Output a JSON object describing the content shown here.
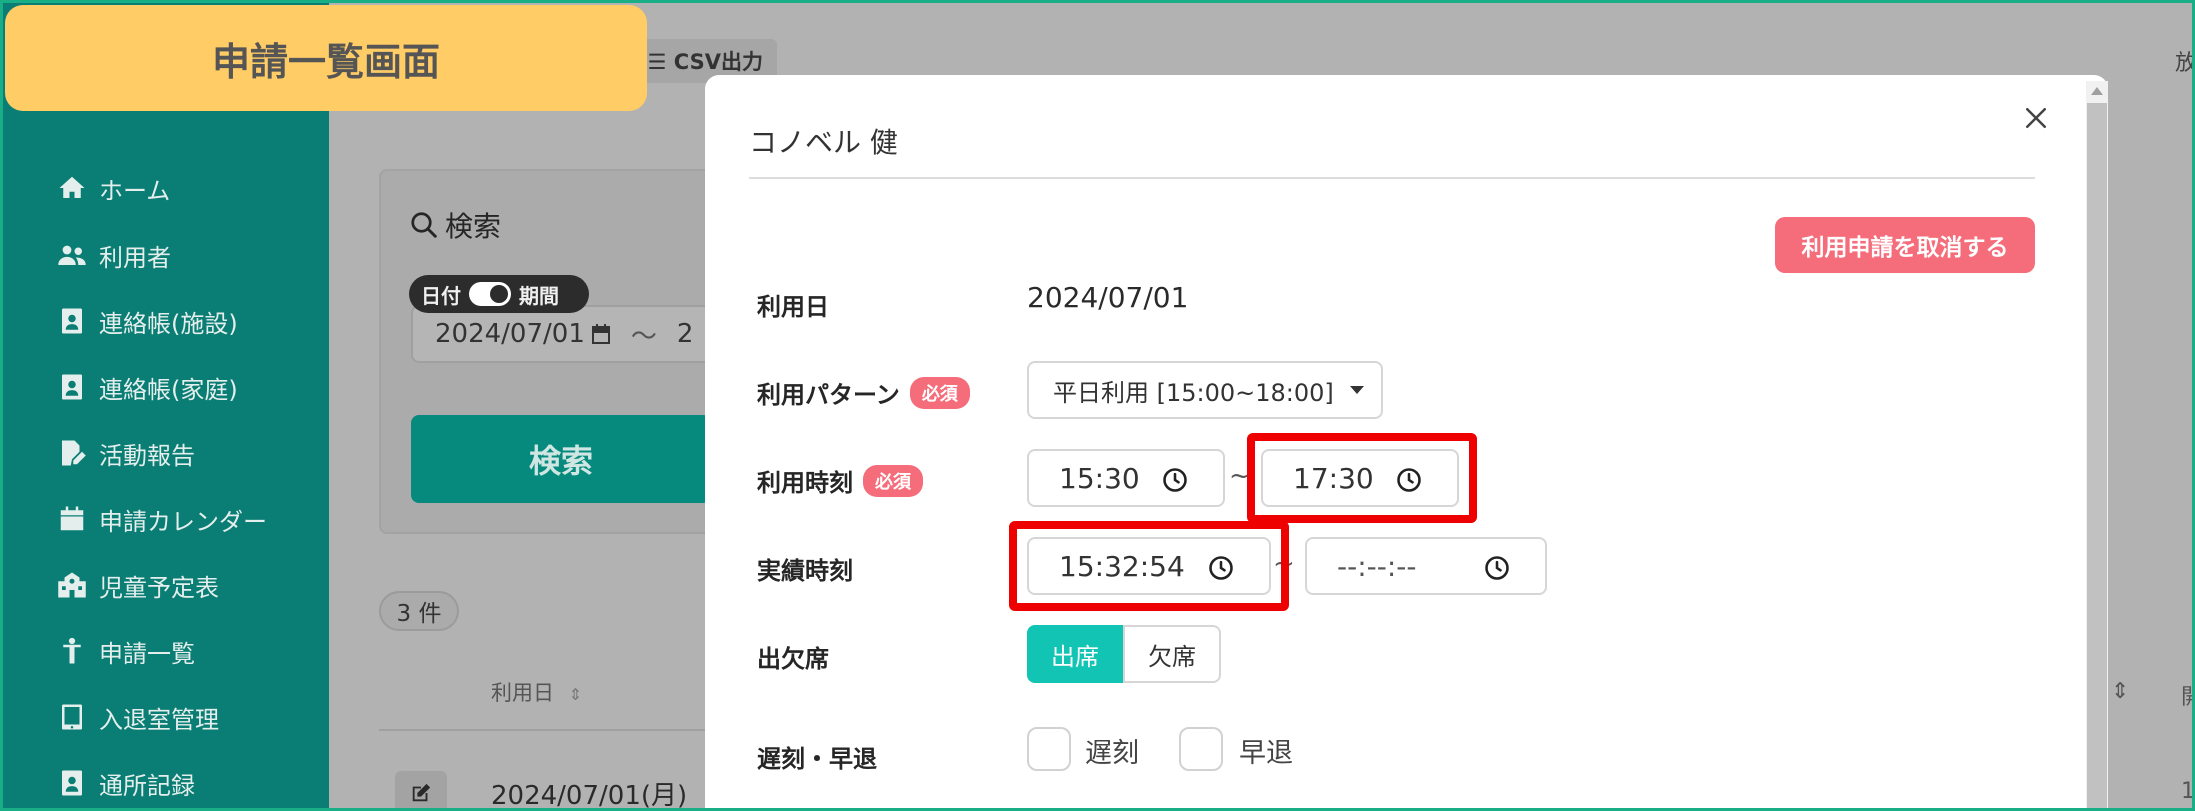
{
  "banner": {
    "title": "申請一覧画面"
  },
  "toolbar": {
    "csv_label": "☰ CSV出力",
    "right_cut_text": "放"
  },
  "sidebar": {
    "items": [
      {
        "label": "ホーム",
        "icon": "home-icon"
      },
      {
        "label": "利用者",
        "icon": "users-icon"
      },
      {
        "label": "連絡帳(施設)",
        "icon": "contact-card-icon"
      },
      {
        "label": "連絡帳(家庭)",
        "icon": "contact-card-icon"
      },
      {
        "label": "活動報告",
        "icon": "report-pen-icon"
      },
      {
        "label": "申請カレンダー",
        "icon": "calendar-icon"
      },
      {
        "label": "児童予定表",
        "icon": "school-icon"
      },
      {
        "label": "申請一覧",
        "icon": "child-icon"
      },
      {
        "label": "入退室管理",
        "icon": "tablet-icon"
      },
      {
        "label": "通所記録",
        "icon": "contact-card-icon"
      }
    ]
  },
  "search": {
    "title": "検索",
    "toggle_date": "日付",
    "toggle_period": "期間",
    "date_value": "2024/07/01",
    "range_separator": "〜",
    "date_end_fragment": "2",
    "button_label": "検索"
  },
  "list": {
    "count": "3 件",
    "col_date": "利用日",
    "row_date": "2024/07/01(月)",
    "right_fragment_a": "開",
    "right_fragment_b": "1"
  },
  "modal": {
    "title": "コノベル 健",
    "cancel_label": "利用申請を取消する",
    "required_label": "必須",
    "fields": {
      "date_label": "利用日",
      "date_value": "2024/07/01",
      "pattern_label": "利用パターン",
      "pattern_value": "平日利用 [15:00~18:00]",
      "time_label": "利用時刻",
      "time_start": "15:30",
      "time_end": "17:30",
      "actual_label": "実績時刻",
      "actual_start": "15:32:54",
      "actual_end": "--:--:--",
      "attendance_label": "出欠席",
      "attend_on": "出席",
      "attend_off": "欠席",
      "late_label": "遅刻・早退",
      "late": "遅刻",
      "early": "早退"
    },
    "tilde": "~"
  },
  "colors": {
    "sidebar": "#0a7e74",
    "banner": "#ffcc66",
    "accent_teal": "#11c4b3",
    "danger": "#f56c7a",
    "highlight": "#ee0000"
  }
}
